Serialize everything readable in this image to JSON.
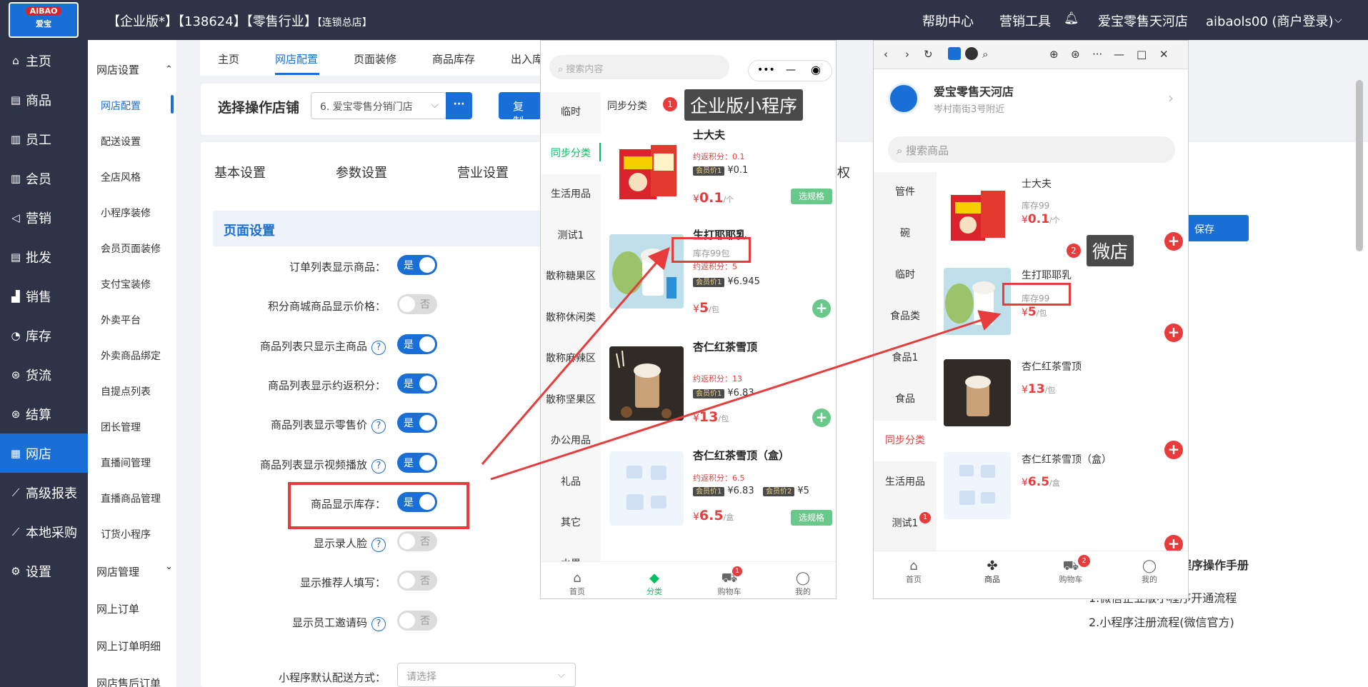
{
  "topbar": {
    "logo_top": "AIBAO",
    "logo_bottom": "爱宝",
    "title_main": "【企业版*】【138624】【零售行业】",
    "title_small": "【连锁总店】",
    "help": "帮助中心",
    "marketing": "营销工具",
    "store": "爱宝零售天河店",
    "user": "aibaols00 (商户登录)"
  },
  "sidebar": {
    "items": [
      {
        "icon": "⌂",
        "label": "主页"
      },
      {
        "icon": "▤",
        "label": "商品"
      },
      {
        "icon": "▥",
        "label": "员工"
      },
      {
        "icon": "▥",
        "label": "会员"
      },
      {
        "icon": "◁",
        "label": "营销"
      },
      {
        "icon": "▤",
        "label": "批发"
      },
      {
        "icon": "▟",
        "label": "销售"
      },
      {
        "icon": "◔",
        "label": "库存"
      },
      {
        "icon": "⊛",
        "label": "货流"
      },
      {
        "icon": "⊛",
        "label": "结算"
      },
      {
        "icon": "▦",
        "label": "网店"
      },
      {
        "icon": "⟋",
        "label": "高级报表"
      },
      {
        "icon": "⟋",
        "label": "本地采购"
      },
      {
        "icon": "⚙",
        "label": "设置"
      }
    ]
  },
  "subnav": {
    "group1": "网店设置",
    "items": [
      "网店配置",
      "配送设置",
      "全店风格",
      "小程序装修",
      "会员页面装修",
      "支付宝装修",
      "外卖平台",
      "外卖商品绑定",
      "自提点列表",
      "团长管理",
      "直播间管理",
      "直播商品管理",
      "订货小程序"
    ],
    "group2": "网店管理",
    "items2": [
      "网上订单",
      "网上订单明细",
      "网店售后订单"
    ]
  },
  "tabs": [
    "主页",
    "网店配置",
    "页面装修",
    "商品库存",
    "出入库"
  ],
  "store_select": {
    "label": "选择操作店铺",
    "value": "6. 爱宝零售分销门店",
    "more": "···",
    "copy": "复制"
  },
  "settings_tabs": [
    "基本设置",
    "参数设置",
    "营业设置"
  ],
  "settings_tab_tail": "权",
  "section_title": "页面设置",
  "on_text": "是",
  "off_text": "否",
  "settings": [
    {
      "label": "订单列表显示商品：",
      "help": false,
      "on": true
    },
    {
      "label": "积分商城商品显示价格：",
      "help": false,
      "on": false
    },
    {
      "label": "商品列表只显示主商品",
      "help": true,
      "on": true
    },
    {
      "label": "商品列表显示约返积分：",
      "help": false,
      "on": true
    },
    {
      "label": "商品列表显示零售价",
      "help": true,
      "on": true
    },
    {
      "label": "商品列表显示视频播放",
      "help": true,
      "on": true
    },
    {
      "label": "商品显示库存：",
      "help": false,
      "on": true
    },
    {
      "label": "显示录人脸",
      "help": true,
      "on": false
    },
    {
      "label": "显示推荐人填写：",
      "help": false,
      "on": false
    },
    {
      "label": "显示员工邀请码",
      "help": true,
      "on": false
    }
  ],
  "delivery": {
    "label": "小程序默认配送方式：",
    "placeholder": "请选择"
  },
  "save": "保存",
  "manual": {
    "title": "程序操作手册",
    "links": [
      "1.微信企业版小程序开通流程",
      "2.小程序注册流程(微信官方)"
    ]
  },
  "phone1": {
    "search_placeholder": "搜索内容",
    "capsule_dots": "•••",
    "capsule_minus": "—",
    "capsule_target": "◉",
    "categories": [
      "临时",
      "同步分类",
      "生活用品",
      "测试1",
      "散称糖果区",
      "散称休闲类",
      "散称麻辣区",
      "散称坚果区",
      "办公用品",
      "礼品",
      "其它",
      "水果"
    ],
    "active_category": "同步分类",
    "header": "同步分类",
    "badge": "1",
    "tag": "企业版小程序",
    "products": [
      {
        "name": "士大夫",
        "points": "约返积分：0.1",
        "member": "会员价1",
        "member_price": "¥0.1",
        "member2": "",
        "member2_price": "",
        "stock": "",
        "price_symbol": "¥",
        "price": "0.1",
        "unit": "/个",
        "action": "选规格"
      },
      {
        "name": "生打耶耶乳",
        "points": "约返积分：5",
        "member": "会员价1",
        "member_price": "¥6.945",
        "member2": "",
        "member2_price": "",
        "stock": "库存99包",
        "price_symbol": "¥",
        "price": "5",
        "unit": "/包",
        "action": "+"
      },
      {
        "name": "杏仁红茶雪顶",
        "points": "约返积分：13",
        "member": "会员价1",
        "member_price": "¥6.83",
        "member2": "",
        "member2_price": "",
        "stock": "",
        "price_symbol": "¥",
        "price": "13",
        "unit": "/包",
        "action": "+"
      },
      {
        "name": "杏仁红茶雪顶（盒）",
        "points": "约返积分：6.5",
        "member": "会员价1",
        "member_price": "¥6.83",
        "member2": "会员价2",
        "member2_price": "¥5",
        "stock": "",
        "price_symbol": "¥",
        "price": "6.5",
        "unit": "/盒",
        "action": "选规格"
      }
    ],
    "nav": [
      {
        "icon": "⌂",
        "label": "首页"
      },
      {
        "icon": "◆",
        "label": "分类"
      },
      {
        "icon": "⛟",
        "label": "购物车"
      },
      {
        "icon": "◯",
        "label": "我的"
      }
    ],
    "cart_badge": "1"
  },
  "phone2": {
    "shop_name": "爱宝零售天河店",
    "shop_addr": "岑村南街3号附近",
    "search_placeholder": "搜索商品",
    "categories": [
      "管件",
      "碗",
      "临时",
      "食品类",
      "食品1",
      "食品",
      "同步分类",
      "生活用品",
      "测试1"
    ],
    "active_category": "同步分类",
    "cat_badge": "1",
    "badge": "2",
    "tag": "微店",
    "products": [
      {
        "name": "士大夫",
        "stock": "库存99",
        "price_symbol": "¥",
        "price": "0.1",
        "unit": "/个"
      },
      {
        "name": "生打耶耶乳",
        "stock": "库存99",
        "price_symbol": "¥",
        "price": "5",
        "unit": "/包"
      },
      {
        "name": "杏仁红茶雪顶",
        "stock": "",
        "price_symbol": "¥",
        "price": "13",
        "unit": "/包"
      },
      {
        "name": "杏仁红茶雪顶（盒）",
        "stock": "",
        "price_symbol": "¥",
        "price": "6.5",
        "unit": "/盒"
      }
    ],
    "nav": [
      {
        "icon": "⌂",
        "label": "首页"
      },
      {
        "icon": "✤",
        "label": "商品"
      },
      {
        "icon": "⛟",
        "label": "购物车"
      },
      {
        "icon": "◯",
        "label": "我的"
      }
    ],
    "cart_badge": "2"
  },
  "colors": {
    "primary": "#1a6fd6",
    "dark": "#2f3348",
    "red": "#e83b3b",
    "green": "#69c98a"
  }
}
